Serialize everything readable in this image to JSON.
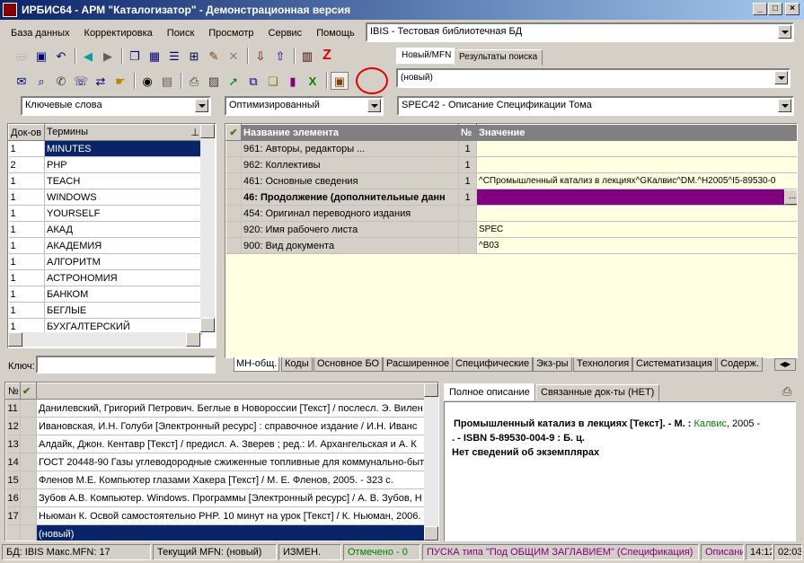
{
  "window": {
    "title": "ИРБИС64 - АРМ \"Каталогизатор\" - Демонстрационная версия",
    "min": "_",
    "max": "□",
    "close": "×"
  },
  "menu": [
    "База данных",
    "Корректировка",
    "Поиск",
    "Просмотр",
    "Сервис",
    "Помощь"
  ],
  "database_select": "IBIS - Тестовая библиотечная БД",
  "record_tabs": [
    "Новый/MFN",
    "Результаты поиска"
  ],
  "record_select": "(новый)",
  "dict_select": "Ключевые слова",
  "mode_select": "Оптимизированный",
  "worksheet_select": "SPEC42 - Описание Спецификации Тома",
  "dictionary": {
    "headers": [
      "Док-ов",
      "Термины"
    ],
    "rows": [
      {
        "count": "1",
        "term": "MINUTES"
      },
      {
        "count": "2",
        "term": "PHP"
      },
      {
        "count": "1",
        "term": "TEACH"
      },
      {
        "count": "1",
        "term": "WINDOWS"
      },
      {
        "count": "1",
        "term": "YOURSELF"
      },
      {
        "count": "1",
        "term": "АКАД"
      },
      {
        "count": "1",
        "term": "АКАДЕМИЯ"
      },
      {
        "count": "1",
        "term": "АЛГОРИТМ"
      },
      {
        "count": "1",
        "term": "АСТРОНОМИЯ"
      },
      {
        "count": "1",
        "term": "БАНКОМ"
      },
      {
        "count": "1",
        "term": "БЕГЛЫЕ"
      },
      {
        "count": "1",
        "term": "БУХГАЛТЕРСКИЙ"
      }
    ],
    "key_label": "Ключ:"
  },
  "editor": {
    "headers": [
      "Название элемента",
      "№",
      "Значение"
    ],
    "rows": [
      {
        "name": "961: Авторы, редакторы ...",
        "num": "1",
        "value": ""
      },
      {
        "name": "962: Коллективы",
        "num": "1",
        "value": ""
      },
      {
        "name": "461: Основные сведения",
        "num": "1",
        "value": "^CПромышленный катализ в лекциях^GКалвис^DM.^H2005^I5-89530-0"
      },
      {
        "name": "46: Продолжение (дополнительные данн",
        "num": "1",
        "value": ""
      },
      {
        "name": "454: Оригинал переводного издания",
        "num": "",
        "value": ""
      },
      {
        "name": "920: Имя рабочего листа",
        "num": "",
        "value": "SPEC"
      },
      {
        "name": "900: Вид документа",
        "num": "",
        "value": "^B03"
      }
    ],
    "ellipsis": "...",
    "bottom_tabs": [
      "МН-общ.",
      "Коды",
      "Основное БО",
      "Расширенное",
      "Специфические",
      "Экз-ры",
      "Технология",
      "Систематизация",
      "Содерж."
    ]
  },
  "records": {
    "rows": [
      {
        "n": "11",
        "text": "Данилевский, Григорий Петрович. Беглые в Новороссии [Текст] / послесл. Э. Вилен"
      },
      {
        "n": "12",
        "text": "Ивановская, И.Н. Голуби [Электронный ресурс] : справочное издание / И.Н. Иванс"
      },
      {
        "n": "13",
        "text": "Алдайк, Джон. Кентавр [Текст] / предисл. А. Зверев ; ред.: И. Архангельская и А. К"
      },
      {
        "n": "14",
        "text": "ГОСТ 20448-90 Газы углеводородные сжиженные топливные для коммунально-быт"
      },
      {
        "n": "15",
        "text": "Фленов М.Е. Компьютер глазами Хакера [Текст] / М. Е. Фленов, 2005. - 323 с."
      },
      {
        "n": "16",
        "text": "Зубов А.В. Компьютер. Windows. Программы [Электронный ресурс] / А. В. Зубов, Н"
      },
      {
        "n": "17",
        "text": "Ньюман К. Освой самостоятельно PHP. 10 минут на урок [Текст] / К. Ньюман, 2006."
      }
    ],
    "new_row": "(новый)"
  },
  "description": {
    "tabs": [
      "Полное описание",
      "Связанные док-ты (НЕТ)"
    ],
    "line1_title": "Промышленный катализ в лекциях [Текст]. - М. :",
    "line1_publisher": "Калвис",
    "line1_year": ", 2005 -",
    "line2": ". - ISBN 5-89530-004-9 : Б. ц.",
    "line3": "Нет сведений об экземплярах"
  },
  "status": {
    "db": "БД: IBIS Макс.MFN: 17",
    "current": "Текущий MFN: (новый)",
    "changed": "ИЗМЕН.",
    "marked": "Отмечено - 0",
    "search": "ПУСКА типа \"Под ОБЩИМ ЗАГЛАВИЕМ\" (Спецификация)",
    "desc": "Описани",
    "time": "14:12",
    "elapsed": "02:03"
  }
}
